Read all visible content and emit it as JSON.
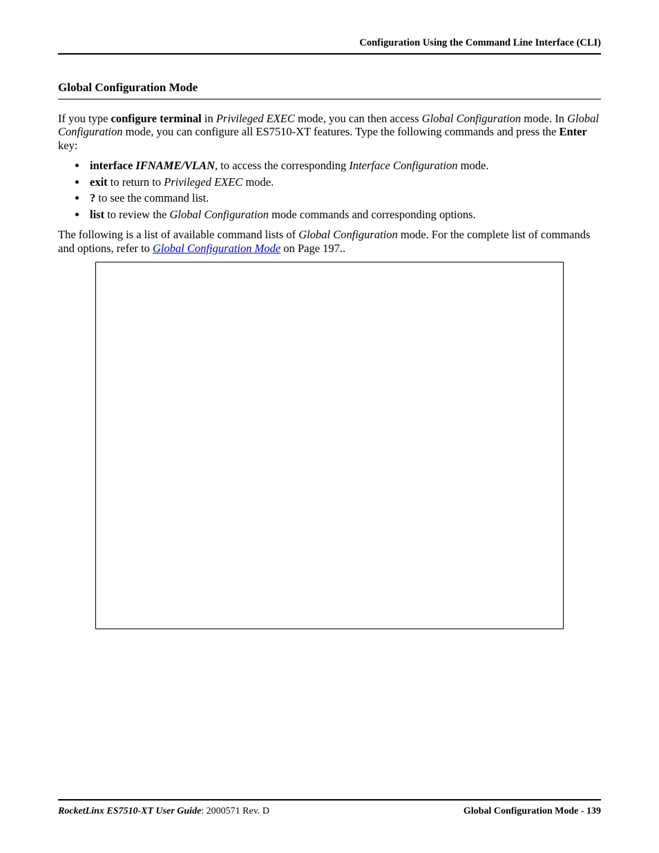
{
  "header": {
    "running_head": "Configuration Using the Command Line Interface (CLI)"
  },
  "section": {
    "title": "Global Configuration Mode",
    "para1": {
      "t1": "If you type ",
      "b1": "configure terminal",
      "t2": " in ",
      "i1": "Privileged EXEC",
      "t3": " mode, you can then access ",
      "i2": "Global Configuration",
      "t4": " mode. In ",
      "i3": "Global Configuration",
      "t5": " mode, you can configure all ES7510-XT features. Type the following commands and press the ",
      "b2": "Enter",
      "t6": " key:"
    },
    "bullets": [
      {
        "b1": "interface",
        "sp": " ",
        "bi": "IFNAME/VLAN",
        "t1": ", to access the corresponding ",
        "i1": "Interface Configuration",
        "t2": " mode."
      },
      {
        "b1": "exit",
        "t1": " to return to ",
        "i1": "Privileged EXEC",
        "t2": " mode."
      },
      {
        "b1": "?",
        "t1": " to see the command list."
      },
      {
        "b1": "list",
        "t1": " to review the ",
        "i1": "Global Configuration",
        "t2": " mode commands and corresponding options."
      }
    ],
    "para2": {
      "t1": "The following is a list of available command lists of ",
      "i1": "Global Configuration",
      "t2": " mode. For the complete list of commands and options, refer to ",
      "link": "Global Configuration Mode",
      "t3": " on Page 197.."
    }
  },
  "footer": {
    "product": "RocketLinx ES7510-XT  User Guide",
    "docrev": ": 2000571 Rev. D",
    "right": "Global Configuration Mode - 139"
  }
}
